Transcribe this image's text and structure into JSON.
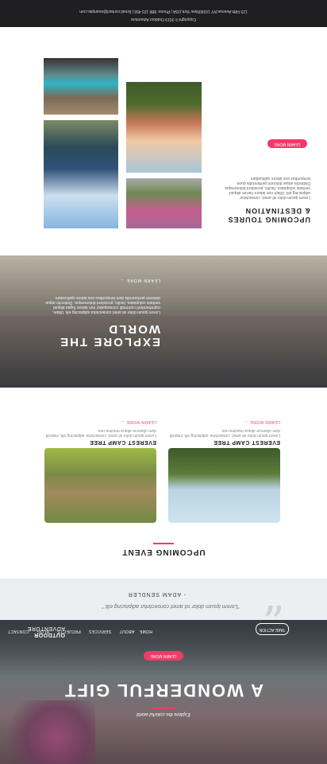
{
  "nav": {
    "brand": {
      "line1": "OUTDOOR",
      "line2": "ADVENTURE"
    },
    "items": [
      "HOME",
      "ABOUT",
      "SERVICES",
      "PROJECTS",
      "BLOG",
      "CONTACT"
    ],
    "cta": "TAKE ACTION"
  },
  "hero": {
    "title": "A WONDERFUL GIFT",
    "subtitle": "Explore the colorful world",
    "button": "LEARN MORE"
  },
  "testimonial": {
    "quote": "\"Lorem ipsum dolor sit amet consectetur adipiscing elit.\"",
    "author": "ADAM SENDLER"
  },
  "events": {
    "title": "UPCOMING EVENT",
    "cards": [
      {
        "name": "EVEREST CAMP TREE",
        "desc": "Lorem ipsum dolor sit amet, consectetur adipiscing elit, impedit dum ullamcor aliqua maxima nos.",
        "link": "LEARN MORE →"
      },
      {
        "name": "EVEREST CAMP TREE",
        "desc": "Lorem ipsum dolor sit amet, consectetur adipiscing elit, impedit dum ullamcor aliqua maxima nos.",
        "link": "LEARN MORE →"
      }
    ]
  },
  "explore": {
    "title": "EXPLORE THE WORLD",
    "text": "Lorem ipsum dolor sit amet consectetur adipiscing elit. Ullam, reprehenderit commodi consequatur non labore fugiat aliquid veritatis voluptates, facilis, provident doloremque. Distinctio atque dolorem perferendis dum temporibus eos labore quibusdam.",
    "link": "LEARN MORE →"
  },
  "tours": {
    "title": "UPCOMING TOURES & DESTINATION",
    "text": "Lorem ipsum dolor sit amet, consectetur adipiscing elit. Ullam non labore harum aliquid veritatis voluptates, facilis, provident doloremque. Distinctio atque dolorem perferendis quos temporibus eos labore quibusdam.",
    "button": "LEARN MORE"
  },
  "footer": {
    "address": "123 Fifth Avenue,NY 10160New York,USA | Phone: 888 123 456 | Email:contact@example.com",
    "copyright": "Copyright © 2019 Outdoor Adventure"
  }
}
